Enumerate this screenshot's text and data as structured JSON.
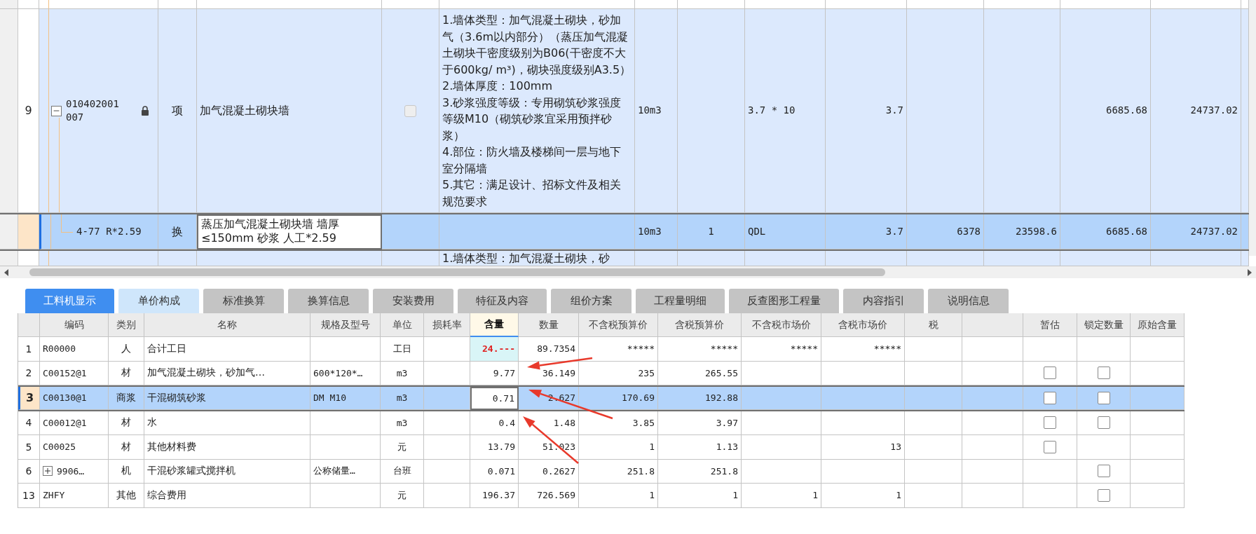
{
  "top_table": {
    "rows": [
      {
        "kind": "partial_top",
        "selected": false
      },
      {
        "kind": "item",
        "selected": false,
        "expanded": true,
        "locked": true,
        "checked": false,
        "row_number": "9",
        "code": "010402001007",
        "type": "项",
        "name": "加气混凝土砌块墙",
        "features": "1.墙体类型：加气混凝土砌块，砂加气（3.6m以内部分）（蒸压加气混凝土砌块干密度级别为B06(干密度不大于600kg/ m³)，砌块强度级别A3.5）\n2.墙体厚度：100mm\n3.砂浆强度等级：专用砌筑砂浆强度等级M10（砌筑砂浆宜采用预拌砂浆）\n4.部位：防火墙及楼梯间一层与地下室分隔墙\n5.其它：满足设计、招标文件及相关规范要求",
        "unit": "10m3",
        "expression": "3.7 * 10",
        "quantity": "3.7",
        "column_12": "6685.68",
        "column_13": "24737.02"
      },
      {
        "kind": "sub",
        "selected": true,
        "code": "4-77 R*2.59",
        "type": "换",
        "name": "蒸压加气混凝土砌块墙 墙厚≤150mm 砂浆  人工*2.59",
        "unit": "10m3",
        "column_7": "1",
        "expression": "QDL",
        "quantity": "3.7",
        "column_10": "6378",
        "column_11": "23598.6",
        "column_12": "6685.68",
        "column_13": "24737.02"
      },
      {
        "kind": "partial_bottom",
        "selected": false,
        "features": "1.墙体类型：加气混凝土砌块，砂"
      }
    ]
  },
  "tabs": [
    {
      "label": "工料机显示",
      "selected": true,
      "hover": false
    },
    {
      "label": "单价构成",
      "selected": false,
      "hover": true
    },
    {
      "label": "标准换算",
      "selected": false,
      "hover": false
    },
    {
      "label": "换算信息",
      "selected": false,
      "hover": false
    },
    {
      "label": "安装费用",
      "selected": false,
      "hover": false
    },
    {
      "label": "特征及内容",
      "selected": false,
      "hover": false
    },
    {
      "label": "组价方案",
      "selected": false,
      "hover": false
    },
    {
      "label": "工程量明细",
      "selected": false,
      "hover": false
    },
    {
      "label": "反查图形工程量",
      "selected": false,
      "hover": false
    },
    {
      "label": "内容指引",
      "selected": false,
      "hover": false
    },
    {
      "label": "说明信息",
      "selected": false,
      "hover": false
    }
  ],
  "resource_table": {
    "columns": [
      {
        "selected": false
      },
      {
        "label": "编码",
        "selected": false
      },
      {
        "label": "类别",
        "selected": false
      },
      {
        "label": "名称",
        "selected": false
      },
      {
        "label": "规格及型号",
        "selected": false
      },
      {
        "label": "单位",
        "selected": false
      },
      {
        "label": "损耗率",
        "selected": false
      },
      {
        "label": "含量",
        "selected": true
      },
      {
        "label": "数量",
        "selected": false
      },
      {
        "label": "不含税预算价",
        "selected": false
      },
      {
        "label": "含税预算价",
        "selected": false
      },
      {
        "label": "不含税市场价",
        "selected": false
      },
      {
        "label": "含税市场价",
        "selected": false
      },
      {
        "label": "税",
        "selected": false
      },
      {
        "selected": false
      },
      {
        "label": "暂估",
        "selected": false
      },
      {
        "label": "锁定数量",
        "selected": false
      },
      {
        "label": "原始含量",
        "selected": false
      }
    ],
    "rows": [
      {
        "selected": false,
        "flagged": true,
        "row_number": "1",
        "code": "R00000",
        "category": "人",
        "name": "合计工日",
        "unit": "工日",
        "content": "24.---",
        "quantity": "89.7354",
        "budget_excl_tax": "*****",
        "budget_incl_tax": "*****",
        "market_excl_tax": "*****",
        "market_incl_tax": "*****"
      },
      {
        "selected": false,
        "flagged": false,
        "row_number": "2",
        "code": "C00152@1",
        "category": "材",
        "name": "加气混凝土砌块，砂加气…",
        "spec": "600*120*…",
        "unit": "m3",
        "content": "9.77",
        "quantity": "36.149",
        "budget_excl_tax": "235",
        "budget_incl_tax": "265.55",
        "provisional": false,
        "lock_quantity": false
      },
      {
        "selected": true,
        "flagged": false,
        "row_number": "3",
        "code": "C00130@1",
        "category": "商浆",
        "name": "干混砌筑砂浆",
        "spec": "DM M10",
        "unit": "m3",
        "content": "0.71",
        "quantity": "2.627",
        "budget_excl_tax": "170.69",
        "budget_incl_tax": "192.88",
        "provisional": false,
        "lock_quantity": false
      },
      {
        "selected": false,
        "flagged": false,
        "row_number": "4",
        "code": "C00012@1",
        "category": "材",
        "name": "水",
        "unit": "m3",
        "content": "0.4",
        "quantity": "1.48",
        "budget_excl_tax": "3.85",
        "budget_incl_tax": "3.97",
        "provisional": false,
        "lock_quantity": false
      },
      {
        "selected": false,
        "flagged": false,
        "row_number": "5",
        "code": "C00025",
        "category": "材",
        "name": "其他材料费",
        "unit": "元",
        "content": "13.79",
        "quantity": "51.023",
        "budget_excl_tax": "1",
        "budget_incl_tax": "1.13",
        "market_incl_tax": "13",
        "provisional": false
      },
      {
        "selected": false,
        "flagged": false,
        "expanded": false,
        "row_number": "6",
        "code": "9906…",
        "category": "机",
        "name": "干混砂浆罐式搅拌机",
        "spec": "公称储量…",
        "unit": "台班",
        "content": "0.071",
        "quantity": "0.2627",
        "budget_excl_tax": "251.8",
        "budget_incl_tax": "251.8",
        "lock_quantity": false
      },
      {
        "selected": false,
        "flagged": false,
        "row_number": "13",
        "code": "ZHFY",
        "category": "其他",
        "name": "综合费用",
        "unit": "元",
        "content": "196.37",
        "quantity": "726.569",
        "budget_excl_tax": "1",
        "budget_incl_tax": "1",
        "market_excl_tax": "1",
        "market_incl_tax": "1",
        "lock_quantity": false
      }
    ]
  }
}
